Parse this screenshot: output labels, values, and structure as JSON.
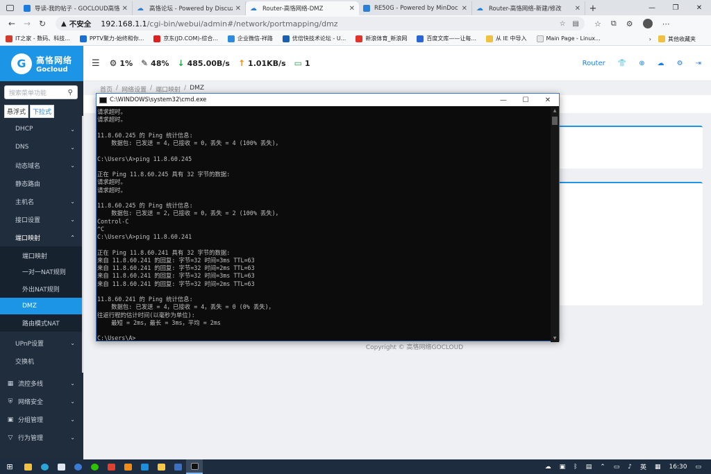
{
  "browser": {
    "tabs": [
      {
        "title": "导读-我的帖子 - GOCLOUD高恪",
        "active": false
      },
      {
        "title": "高恪论坛 - Powered by Discuz!",
        "active": false
      },
      {
        "title": "Router-高恪网络-DMZ",
        "active": true
      },
      {
        "title": "RE50G - Powered by MinDoc",
        "active": false
      },
      {
        "title": "Router-高恪网络-新建/修改",
        "active": false
      }
    ],
    "insecure_label": "不安全",
    "url_host": "192.168.1.1",
    "url_path": "/cgi-bin/webui/admin#/network/portmapping/dmz",
    "bookmarks": [
      {
        "label": "IT之家 - 数码、科技...",
        "color": "#d23a2c"
      },
      {
        "label": "PPTV聚力-始终和你...",
        "color": "#1a6fd6"
      },
      {
        "label": "京东(JD.COM)-综合...",
        "color": "#e0201e"
      },
      {
        "label": "企业微信-祥路",
        "color": "#2a8be0"
      },
      {
        "label": "优倍快技术论坛 - U...",
        "color": "#1a5fb4"
      },
      {
        "label": "新浪体育_新浪网",
        "color": "#e2332a"
      },
      {
        "label": "百度文库——让每...",
        "color": "#2a66d6"
      },
      {
        "label": "从 IE 中导入",
        "color": "#f0c040"
      },
      {
        "label": "Main Page - Linux...",
        "color": "#e6e6e6"
      }
    ],
    "other_bookmarks": "其他收藏夹"
  },
  "app": {
    "logo_cn": "高恪网络",
    "logo_en": "Gocloud",
    "stats": {
      "cpu": "1%",
      "mem": "48%",
      "down": "485.00B/s",
      "up": "1.01KB/s",
      "devices": "1"
    },
    "router_label": "Router",
    "search_placeholder": "搜索菜单功能",
    "mode_float": "悬浮式",
    "mode_dropdown": "下拉式",
    "menu_items": [
      "DHCP",
      "DNS",
      "动态域名",
      "静态路由",
      "主机名",
      "接口设置"
    ],
    "menu_open": "端口映射",
    "submenu": [
      "端口映射",
      "一对一NAT规则",
      "外出NAT规则",
      "DMZ",
      "路由模式NAT"
    ],
    "submenu_active": 3,
    "menu_after": [
      "UPnP设置",
      "交换机"
    ],
    "menu_top": [
      "流控多线",
      "网络安全",
      "分组管理",
      "行为管理"
    ],
    "breadcrumb": [
      "首页",
      "网络设置",
      "端口映射",
      "DMZ"
    ],
    "copyright": "Copyright © 高恪网络GOCLOUD"
  },
  "cmd": {
    "title": "C:\\WINDOWS\\system32\\cmd.exe",
    "lines": [
      "请求超时。",
      "请求超时。",
      "",
      "11.8.60.245 的 Ping 统计信息:",
      "    数据包: 已发送 = 4，已接收 = 0，丢失 = 4 (100% 丢失)，",
      "",
      "C:\\Users\\A>ping 11.8.60.245",
      "",
      "正在 Ping 11.8.60.245 具有 32 字节的数据:",
      "请求超时。",
      "请求超时。",
      "",
      "11.8.60.245 的 Ping 统计信息:",
      "    数据包: 已发送 = 2，已接收 = 0，丢失 = 2 (100% 丢失)，",
      "Control-C",
      "^C",
      "C:\\Users\\A>ping 11.8.60.241",
      "",
      "正在 Ping 11.8.60.241 具有 32 字节的数据:",
      "来自 11.8.60.241 的回复: 字节=32 时间=3ms TTL=63",
      "来自 11.8.60.241 的回复: 字节=32 时间=2ms TTL=63",
      "来自 11.8.60.241 的回复: 字节=32 时间=3ms TTL=63",
      "来自 11.8.60.241 的回复: 字节=32 时间=2ms TTL=63",
      "",
      "11.8.60.241 的 Ping 统计信息:",
      "    数据包: 已发送 = 4，已接收 = 4，丢失 = 0 (0% 丢失)，",
      "往返行程的估计时间(以毫秒为单位):",
      "    最短 = 2ms，最长 = 3ms，平均 = 2ms",
      "",
      "C:\\Users\\A>"
    ]
  },
  "taskbar": {
    "ime": "英",
    "time": "16:30"
  },
  "colors": {
    "accent": "#1c95e6",
    "sidebar": "#1f2d3d",
    "download_arrow": "#22a34a",
    "upload_arrow": "#f08c1a",
    "devices_icon": "#22a34a"
  }
}
